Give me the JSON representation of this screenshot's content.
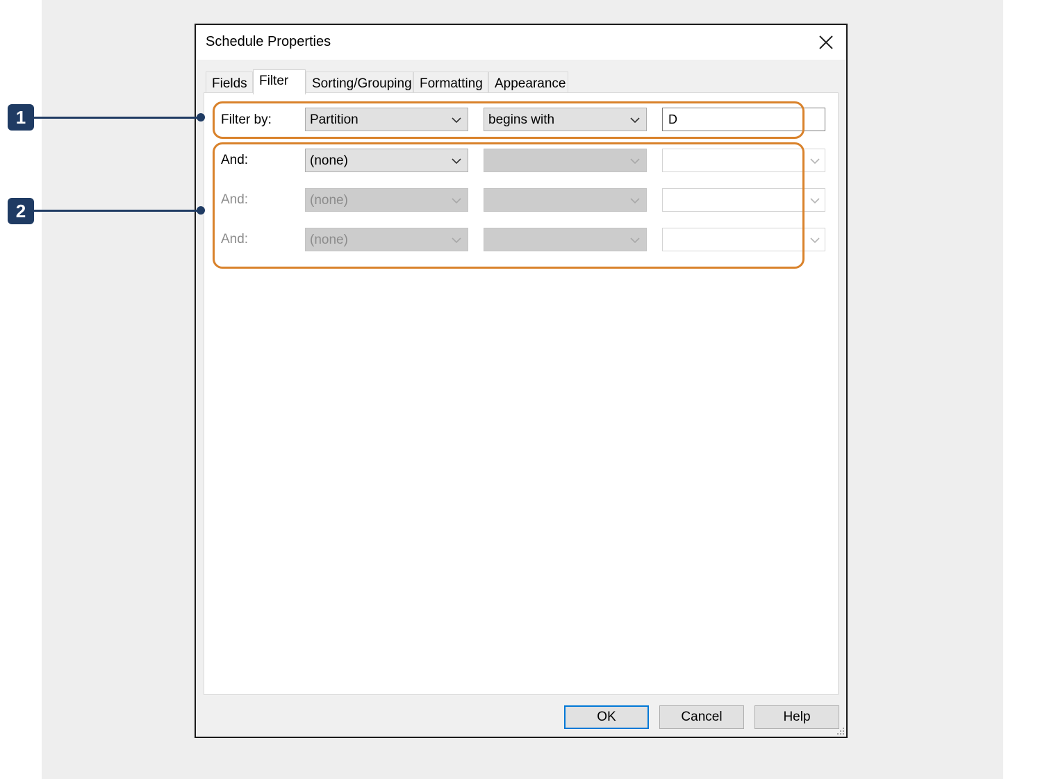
{
  "dialog": {
    "title": "Schedule Properties",
    "tabs": [
      {
        "label": "Fields",
        "active": false
      },
      {
        "label": "Filter",
        "active": true
      },
      {
        "label": "Sorting/Grouping",
        "active": false
      },
      {
        "label": "Formatting",
        "active": false
      },
      {
        "label": "Appearance",
        "active": false
      }
    ],
    "filter_rows": [
      {
        "label": "Filter by:",
        "field": "Partition",
        "condition": "begins with",
        "value": "D",
        "enabled": true
      },
      {
        "label": "And:",
        "field": "(none)",
        "condition": "",
        "value": "",
        "enabled": true
      },
      {
        "label": "And:",
        "field": "(none)",
        "condition": "",
        "value": "",
        "enabled": false
      },
      {
        "label": "And:",
        "field": "(none)",
        "condition": "",
        "value": "",
        "enabled": false
      }
    ],
    "buttons": {
      "ok": "OK",
      "cancel": "Cancel",
      "help": "Help"
    }
  },
  "annotations": {
    "callouts": [
      "1",
      "2"
    ],
    "highlight_color": "#d9822b",
    "callout_color": "#1f3b63"
  }
}
